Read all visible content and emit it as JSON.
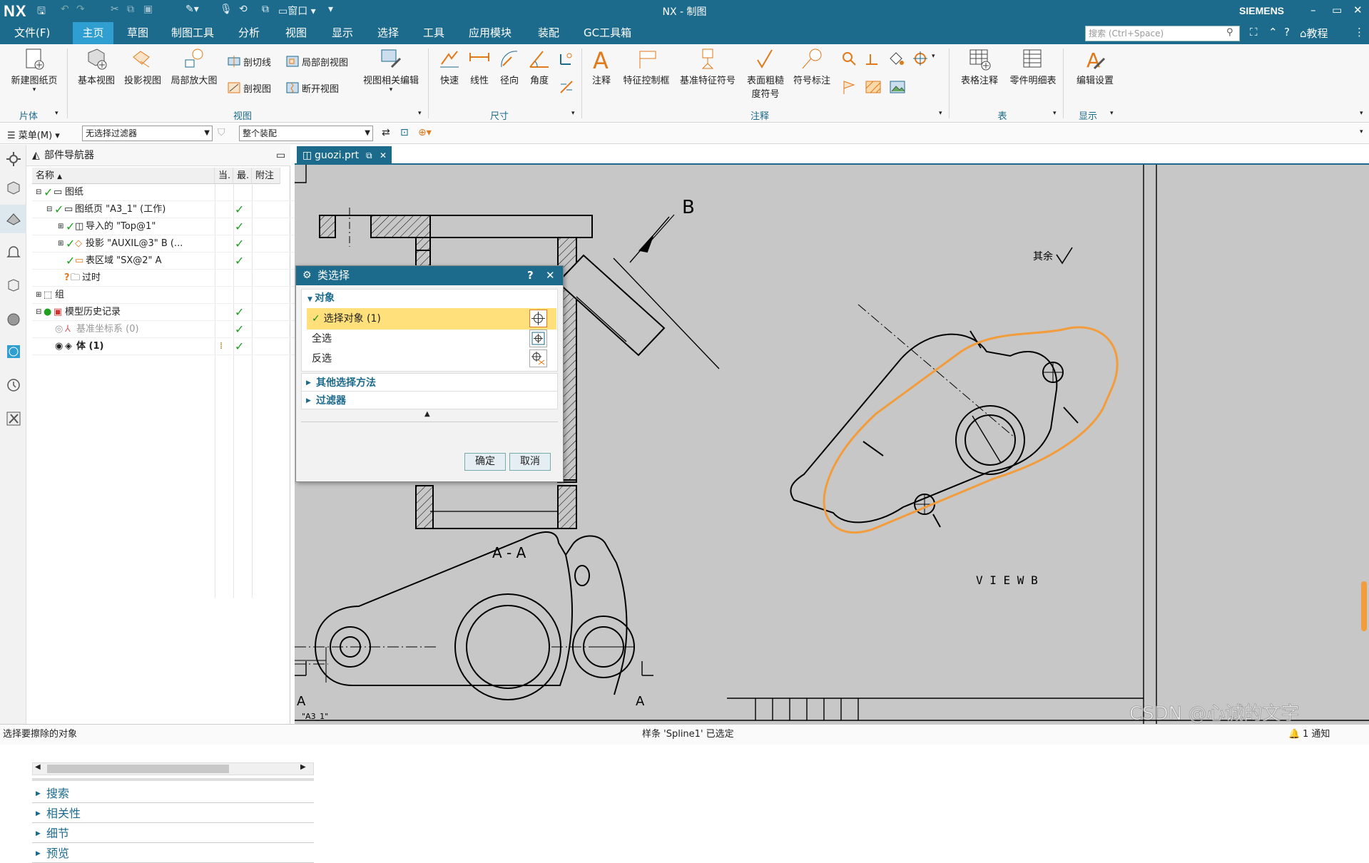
{
  "window": {
    "logo": "NX",
    "title": "NX - 制图",
    "brand": "SIEMENS",
    "quick_access": {
      "window_menu": "窗口"
    },
    "controls": [
      "–",
      "▭",
      "✕"
    ]
  },
  "menu": {
    "items": [
      "文件(F)",
      "主页",
      "草图",
      "制图工具",
      "分析",
      "视图",
      "显示",
      "选择",
      "工具",
      "应用模块",
      "装配",
      "GC工具箱"
    ],
    "active": "主页",
    "search_placeholder": "搜索 (Ctrl+Space)",
    "tutorial": "教程"
  },
  "ribbon": {
    "sheet": {
      "new_sheet": "新建图纸页",
      "label": "片体"
    },
    "view": {
      "base_view": "基本视图",
      "projected_view": "投影视图",
      "detail_view": "局部放大图",
      "section_line": "剖切线",
      "section_view": "剖视图",
      "partial_section": "局部剖视图",
      "break_view": "断开视图",
      "view_edit": "视图相关编辑",
      "label": "视图"
    },
    "dimension": {
      "rapid": "快速",
      "linear": "线性",
      "radial": "径向",
      "angular": "角度",
      "label": "尺寸"
    },
    "annotation": {
      "note": "注释",
      "fcf": "特征控制框",
      "datum": "基准特征符号",
      "surface_finish_1": "表面粗糙",
      "surface_finish_2": "度符号",
      "id_symbol": "符号标注",
      "label": "注释"
    },
    "table": {
      "tabular_note": "表格注释",
      "parts_list": "零件明细表",
      "label": "表"
    },
    "display": {
      "edit_settings": "编辑设置",
      "label": "显示"
    }
  },
  "selection_bar": {
    "menu": "菜单(M)",
    "filter": "无选择过滤器",
    "scope": "整个装配"
  },
  "navigator": {
    "title": "部件导航器",
    "columns": [
      "名称",
      "当.",
      "最.",
      "附注"
    ],
    "rows": [
      {
        "label": "图纸",
        "check": "✓"
      },
      {
        "label": "图纸页 \"A3_1\" (工作)",
        "check": "✓"
      },
      {
        "label": "导入的 \"Top@1\"",
        "check": "✓"
      },
      {
        "label": "投影 \"AUXIL@3\" B (...",
        "check": "✓"
      },
      {
        "label": "表区域 \"SX@2\" A",
        "check": "✓"
      },
      {
        "label": "过时",
        "check": ""
      },
      {
        "label": "组",
        "check": ""
      },
      {
        "label": "模型历史记录",
        "check": "✓"
      },
      {
        "label": "基准坐标系 (0)",
        "check": "✓"
      },
      {
        "label": "体 (1)",
        "check": "✓"
      }
    ],
    "sections": [
      "搜索",
      "相关性",
      "细节",
      "预览"
    ]
  },
  "tab": {
    "name": "guozi.prt"
  },
  "drawing": {
    "label_b": "B",
    "label_aa": "A - A",
    "label_viewb": "V I E W   B",
    "label_rest": "其余",
    "label_a_left": "A",
    "label_a_right": "A",
    "sheet_name": "\"A3_1\""
  },
  "dialog": {
    "title": "类选择",
    "help": "?",
    "section_object": "对象",
    "select_object": "选择对象 (1)",
    "select_all": "全选",
    "invert": "反选",
    "other_methods": "其他选择方法",
    "filter": "过滤器",
    "ok": "确定",
    "cancel": "取消"
  },
  "status": {
    "left": "选择要擦除的对象",
    "center": "样条 'Spline1' 已选定",
    "right": "1 通知"
  },
  "watermark": "CSDN @心诚的文字",
  "colors": {
    "brand": "#1d6b8c",
    "active_tab": "#2e9fd0",
    "highlight": "#ffe07a",
    "selection": "#f39c3c"
  }
}
